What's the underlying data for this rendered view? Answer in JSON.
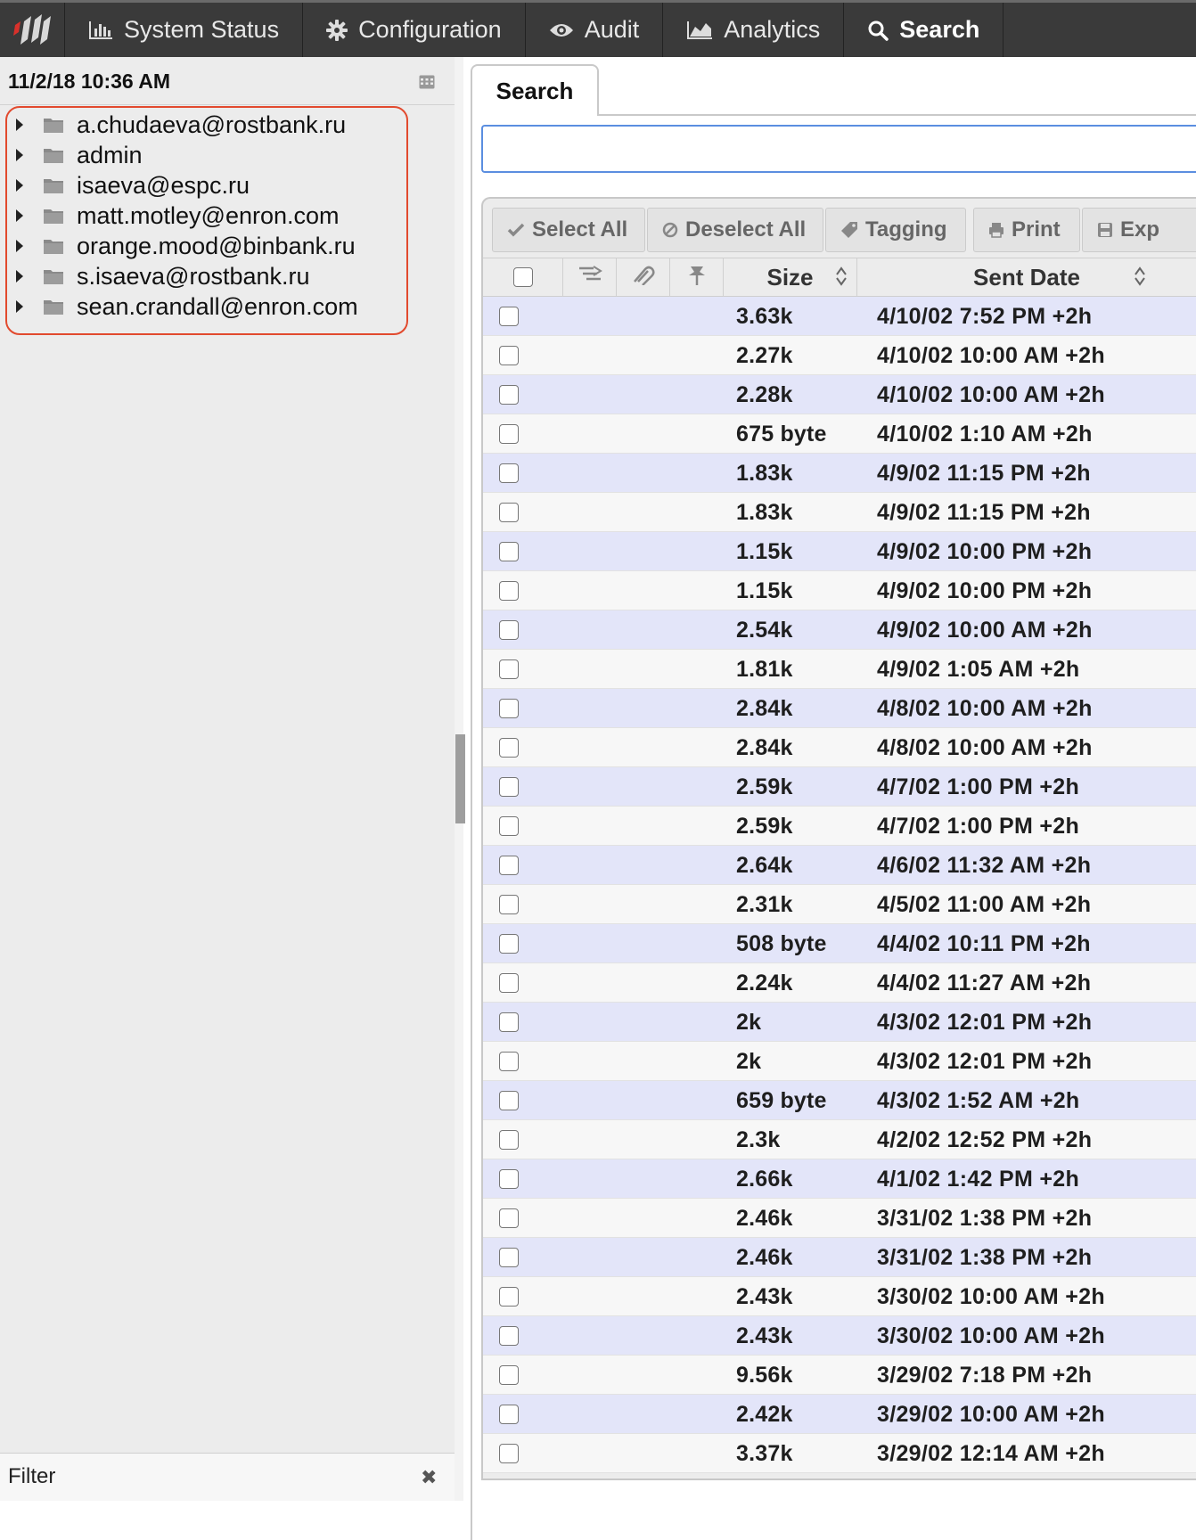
{
  "nav": {
    "items": [
      {
        "label": "System Status",
        "icon": "bar-chart-icon"
      },
      {
        "label": "Configuration",
        "icon": "gear-icon"
      },
      {
        "label": "Audit",
        "icon": "eye-icon"
      },
      {
        "label": "Analytics",
        "icon": "area-chart-icon"
      },
      {
        "label": "Search",
        "icon": "search-icon",
        "active": true
      }
    ]
  },
  "sidebar": {
    "date": "11/2/18 10:36 AM",
    "tree": [
      "a.chudaeva@rostbank.ru",
      "admin",
      "isaeva@espc.ru",
      "matt.motley@enron.com",
      "orange.mood@binbank.ru",
      "s.isaeva@rostbank.ru",
      "sean.crandall@enron.com"
    ],
    "filter_placeholder": "Filter",
    "filter_clear": "✖"
  },
  "main": {
    "tab_label": "Search",
    "search_value": "",
    "toolbar": {
      "select_all": "Select All",
      "deselect_all": "Deselect All",
      "tagging": "Tagging",
      "print": "Print",
      "export": "Exp"
    },
    "columns": {
      "size": "Size",
      "sent_date": "Sent Date"
    },
    "rows": [
      {
        "size": "3.63k",
        "sent": "4/10/02 7:52 PM +2h"
      },
      {
        "size": "2.27k",
        "sent": "4/10/02 10:00 AM +2h"
      },
      {
        "size": "2.28k",
        "sent": "4/10/02 10:00 AM +2h"
      },
      {
        "size": "675 byte",
        "sent": "4/10/02 1:10 AM +2h"
      },
      {
        "size": "1.83k",
        "sent": "4/9/02 11:15 PM +2h"
      },
      {
        "size": "1.83k",
        "sent": "4/9/02 11:15 PM +2h"
      },
      {
        "size": "1.15k",
        "sent": "4/9/02 10:00 PM +2h"
      },
      {
        "size": "1.15k",
        "sent": "4/9/02 10:00 PM +2h"
      },
      {
        "size": "2.54k",
        "sent": "4/9/02 10:00 AM +2h"
      },
      {
        "size": "1.81k",
        "sent": "4/9/02 1:05 AM +2h"
      },
      {
        "size": "2.84k",
        "sent": "4/8/02 10:00 AM +2h"
      },
      {
        "size": "2.84k",
        "sent": "4/8/02 10:00 AM +2h"
      },
      {
        "size": "2.59k",
        "sent": "4/7/02 1:00 PM +2h"
      },
      {
        "size": "2.59k",
        "sent": "4/7/02 1:00 PM +2h"
      },
      {
        "size": "2.64k",
        "sent": "4/6/02 11:32 AM +2h"
      },
      {
        "size": "2.31k",
        "sent": "4/5/02 11:00 AM +2h"
      },
      {
        "size": "508 byte",
        "sent": "4/4/02 10:11 PM +2h"
      },
      {
        "size": "2.24k",
        "sent": "4/4/02 11:27 AM +2h"
      },
      {
        "size": "2k",
        "sent": "4/3/02 12:01 PM +2h"
      },
      {
        "size": "2k",
        "sent": "4/3/02 12:01 PM +2h"
      },
      {
        "size": "659 byte",
        "sent": "4/3/02 1:52 AM +2h"
      },
      {
        "size": "2.3k",
        "sent": "4/2/02 12:52 PM +2h"
      },
      {
        "size": "2.66k",
        "sent": "4/1/02 1:42 PM +2h"
      },
      {
        "size": "2.46k",
        "sent": "3/31/02 1:38 PM +2h"
      },
      {
        "size": "2.46k",
        "sent": "3/31/02 1:38 PM +2h"
      },
      {
        "size": "2.43k",
        "sent": "3/30/02 10:00 AM +2h"
      },
      {
        "size": "2.43k",
        "sent": "3/30/02 10:00 AM +2h"
      },
      {
        "size": "9.56k",
        "sent": "3/29/02 7:18 PM +2h"
      },
      {
        "size": "2.42k",
        "sent": "3/29/02 10:00 AM +2h"
      },
      {
        "size": "3.37k",
        "sent": "3/29/02 12:14 AM +2h"
      }
    ]
  }
}
